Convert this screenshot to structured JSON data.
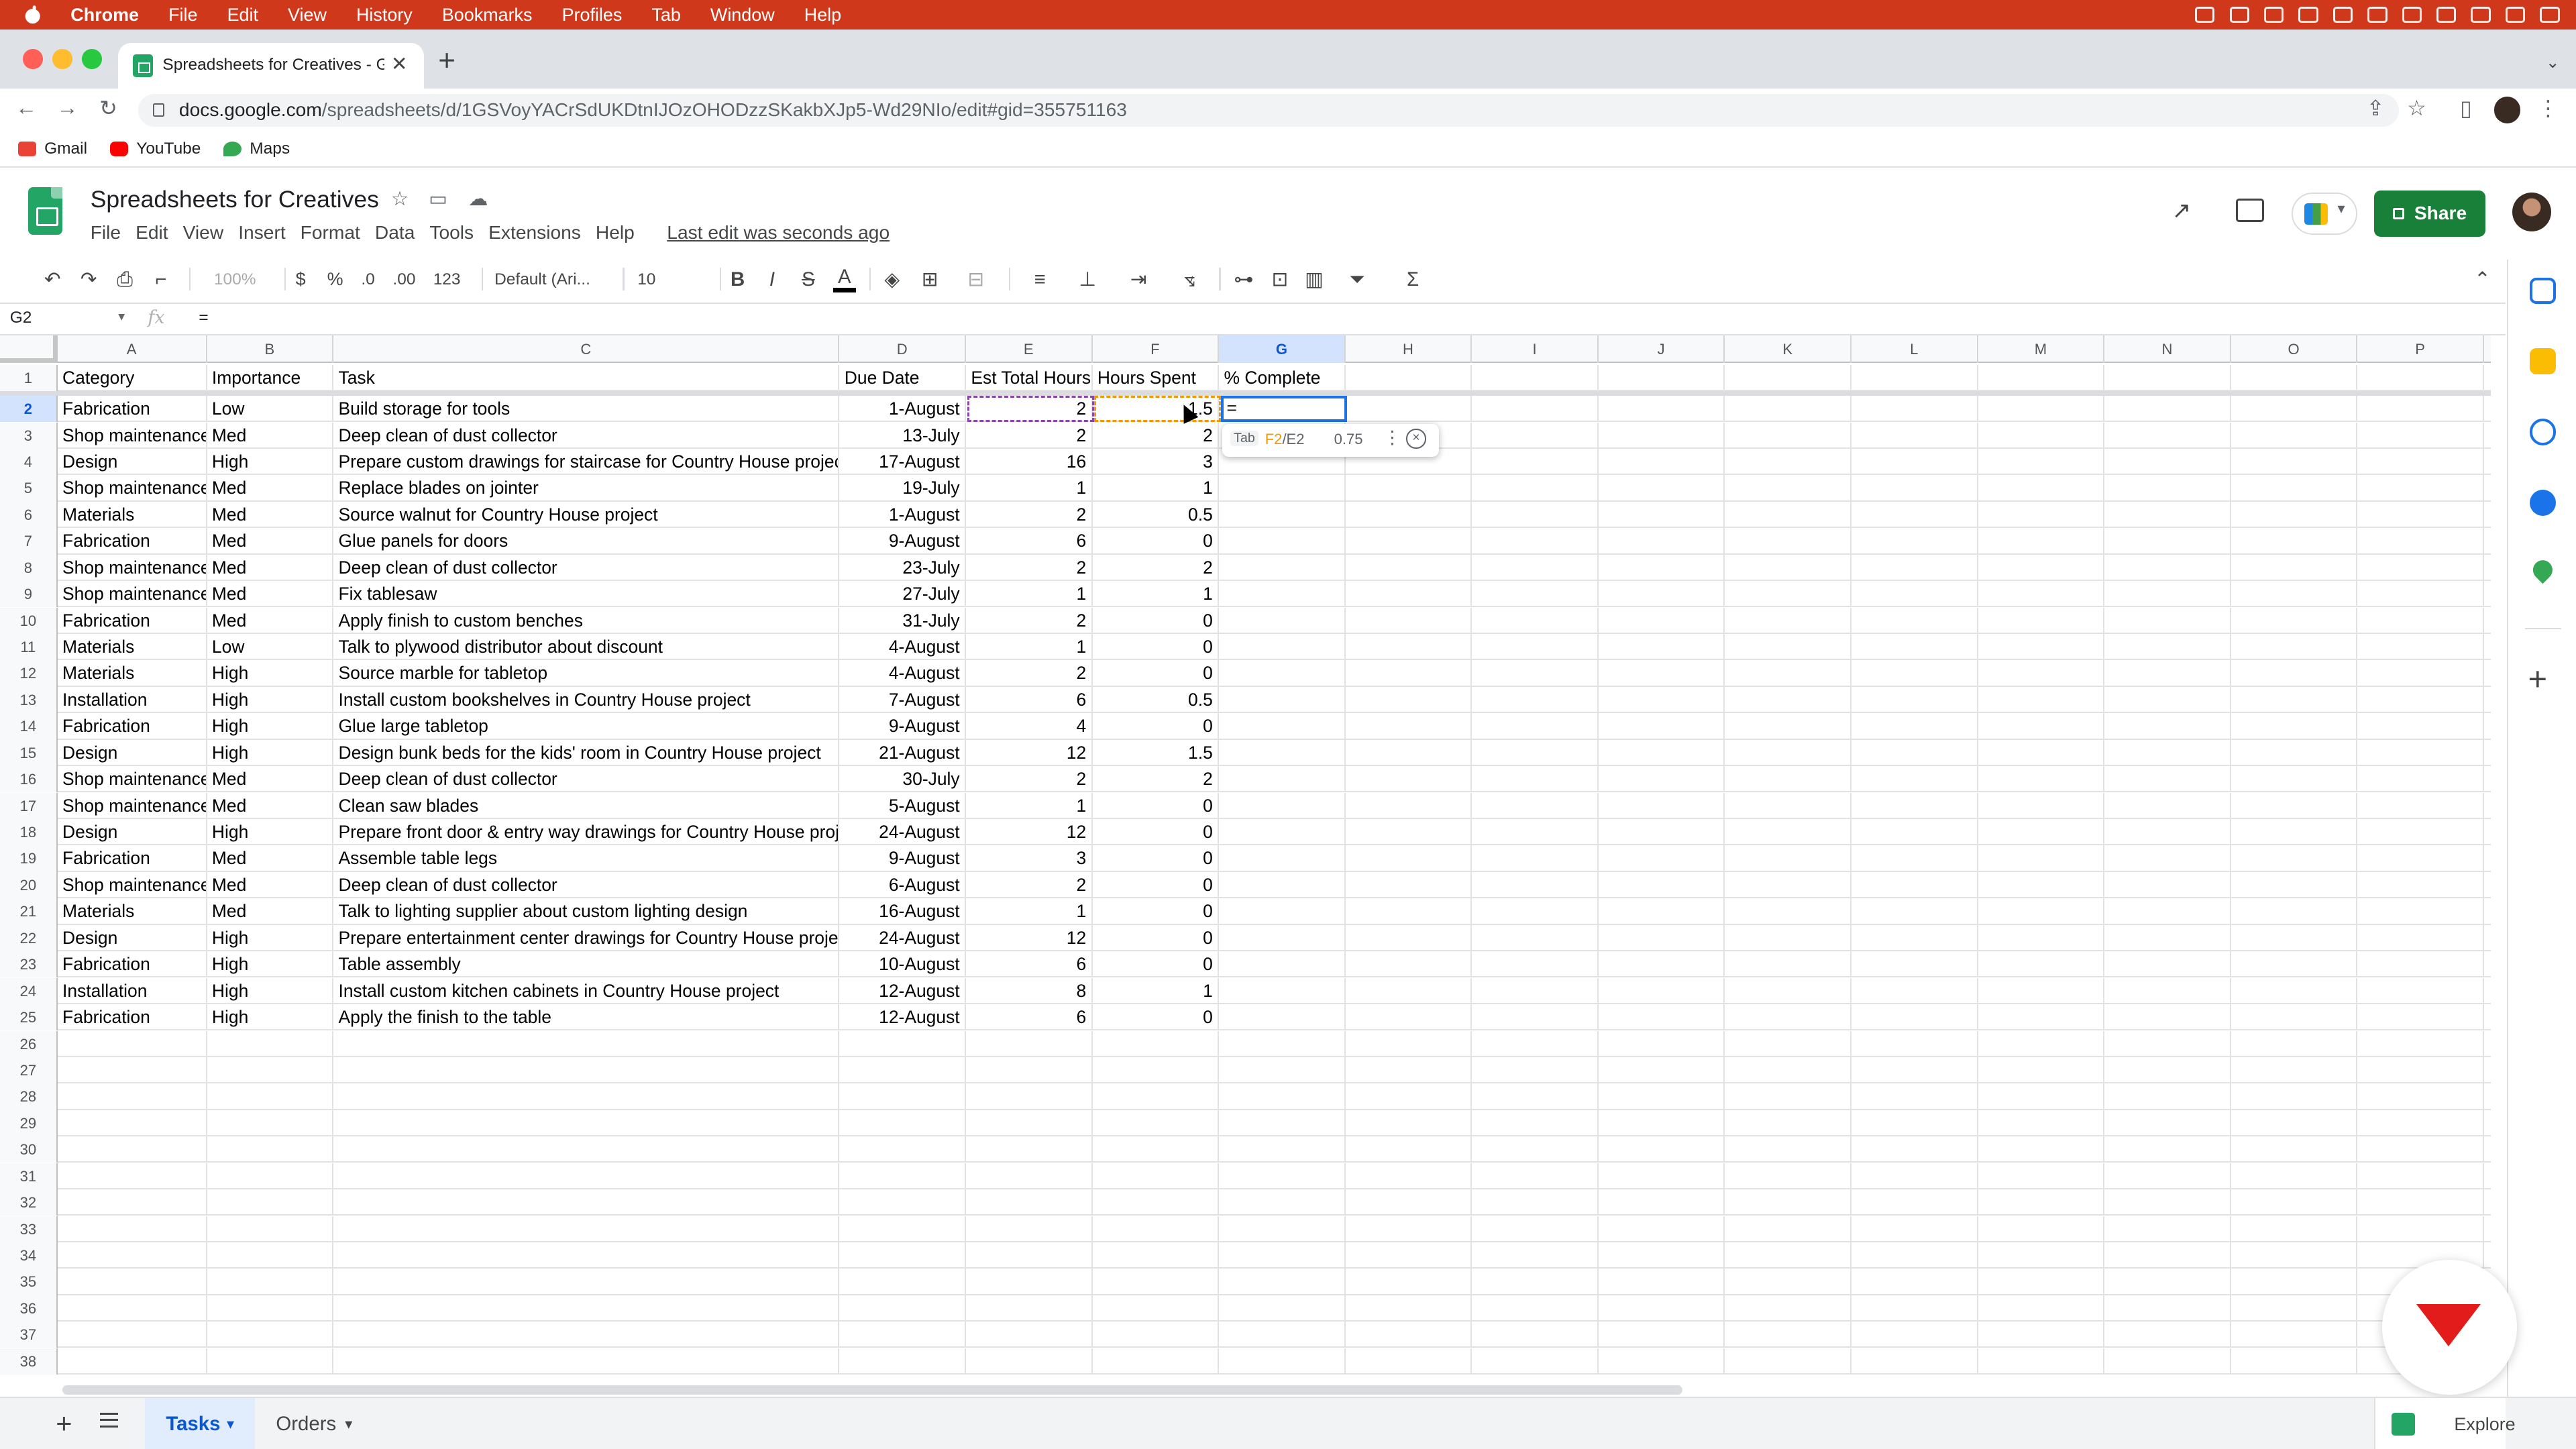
{
  "macbar": {
    "app": "Chrome",
    "menus": [
      "File",
      "Edit",
      "View",
      "History",
      "Bookmarks",
      "Profiles",
      "Tab",
      "Window",
      "Help"
    ]
  },
  "browser": {
    "tab_title": "Spreadsheets for Creatives - G",
    "url_domain": "docs.google.com",
    "url_path": "/spreadsheets/d/1GSVoyYACrSdUKDtnIJOzOHODzzSKakbXJp5-Wd29NIo/edit#gid=355751163",
    "bookmarks": [
      "Gmail",
      "YouTube",
      "Maps"
    ]
  },
  "doc": {
    "title": "Spreadsheets for Creatives",
    "menus": [
      "File",
      "Edit",
      "View",
      "Insert",
      "Format",
      "Data",
      "Tools",
      "Extensions",
      "Help"
    ],
    "last_edit": "Last edit was seconds ago",
    "share_label": "Share"
  },
  "toolbar": {
    "zoom": "100%",
    "currency": "$",
    "percent": "%",
    "dec_less": ".0",
    "dec_more": ".00",
    "format": "123",
    "font": "Default (Ari...",
    "font_size": "10",
    "bold": "B",
    "italic": "I",
    "strike": "S",
    "textcolor": "A",
    "sum": "Σ"
  },
  "formula_bar": {
    "cell_ref": "G2",
    "fx": "fx",
    "content": "="
  },
  "grid": {
    "columns": [
      "A",
      "B",
      "C",
      "D",
      "E",
      "F",
      "G",
      "H",
      "I",
      "J",
      "K",
      "L",
      "M",
      "N",
      "O",
      "P"
    ],
    "header": [
      "Category",
      "Importance",
      "Task",
      "Due Date",
      "Est Total Hours",
      "Hours Spent",
      "% Complete"
    ],
    "rows": [
      [
        "Fabrication",
        "Low",
        "Build storage for tools",
        "1-August",
        "2",
        "1.5"
      ],
      [
        "Shop maintenance",
        "Med",
        "Deep clean of dust collector",
        "13-July",
        "2",
        "2"
      ],
      [
        "Design",
        "High",
        "Prepare custom drawings for staircase for Country House project",
        "17-August",
        "16",
        "3"
      ],
      [
        "Shop maintenance",
        "Med",
        "Replace blades on jointer",
        "19-July",
        "1",
        "1"
      ],
      [
        "Materials",
        "Med",
        "Source walnut for Country House project",
        "1-August",
        "2",
        "0.5"
      ],
      [
        "Fabrication",
        "Med",
        "Glue panels for doors",
        "9-August",
        "6",
        "0"
      ],
      [
        "Shop maintenance",
        "Med",
        "Deep clean of dust collector",
        "23-July",
        "2",
        "2"
      ],
      [
        "Shop maintenance",
        "Med",
        "Fix tablesaw",
        "27-July",
        "1",
        "1"
      ],
      [
        "Fabrication",
        "Med",
        "Apply finish to custom benches",
        "31-July",
        "2",
        "0"
      ],
      [
        "Materials",
        "Low",
        "Talk to plywood distributor about discount",
        "4-August",
        "1",
        "0"
      ],
      [
        "Materials",
        "High",
        "Source marble for tabletop",
        "4-August",
        "2",
        "0"
      ],
      [
        "Installation",
        "High",
        "Install custom bookshelves in Country House project",
        "7-August",
        "6",
        "0.5"
      ],
      [
        "Fabrication",
        "High",
        "Glue large tabletop",
        "9-August",
        "4",
        "0"
      ],
      [
        "Design",
        "High",
        "Design bunk beds for the kids' room in Country House project",
        "21-August",
        "12",
        "1.5"
      ],
      [
        "Shop maintenance",
        "Med",
        "Deep clean of dust collector",
        "30-July",
        "2",
        "2"
      ],
      [
        "Shop maintenance",
        "Med",
        "Clean saw blades",
        "5-August",
        "1",
        "0"
      ],
      [
        "Design",
        "High",
        "Prepare front door & entry way drawings for Country House project",
        "24-August",
        "12",
        "0"
      ],
      [
        "Fabrication",
        "Med",
        "Assemble table legs",
        "9-August",
        "3",
        "0"
      ],
      [
        "Shop maintenance",
        "Med",
        "Deep clean of dust collector",
        "6-August",
        "2",
        "0"
      ],
      [
        "Materials",
        "Med",
        "Talk to lighting supplier about custom lighting design",
        "16-August",
        "1",
        "0"
      ],
      [
        "Design",
        "High",
        "Prepare entertainment center drawings for Country House project",
        "24-August",
        "12",
        "0"
      ],
      [
        "Fabrication",
        "High",
        "Table assembly",
        "10-August",
        "6",
        "0"
      ],
      [
        "Installation",
        "High",
        "Install custom kitchen cabinets in Country House project",
        "12-August",
        "8",
        "1"
      ],
      [
        "Fabrication",
        "High",
        "Apply the finish to the table",
        "12-August",
        "6",
        "0"
      ]
    ],
    "active_cell_value": "=",
    "row_count": 38
  },
  "formula_hint": {
    "key": "Tab",
    "formula_ref1": "F2",
    "formula_rest": "/E2",
    "result": "0.75"
  },
  "sheets": {
    "tabs": [
      "Tasks",
      "Orders"
    ],
    "explore": "Explore"
  }
}
